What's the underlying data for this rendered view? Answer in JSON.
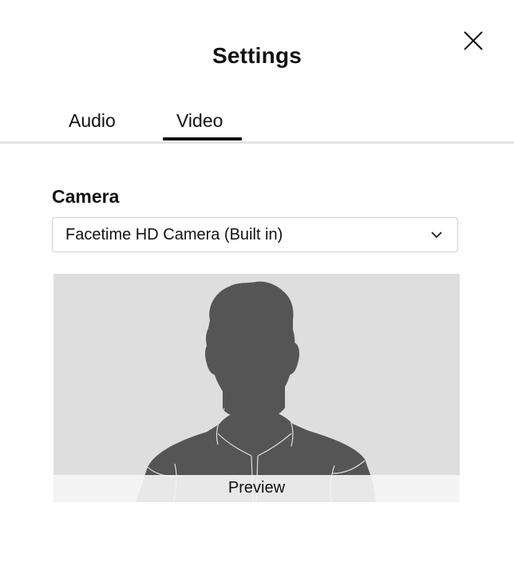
{
  "dialog": {
    "title": "Settings"
  },
  "tabs": [
    {
      "label": "Audio",
      "selected": false
    },
    {
      "label": "Video",
      "selected": true
    }
  ],
  "camera": {
    "section_label": "Camera",
    "selected_device": "Facetime HD Camera (Built in)"
  },
  "preview": {
    "label": "Preview"
  },
  "icons": {
    "close": "close-icon",
    "dropdown": "chevron-down-icon"
  },
  "colors": {
    "text": "#121212",
    "tab_underline": "#121212",
    "preview_background": "#dedede",
    "silhouette": "#555555"
  }
}
